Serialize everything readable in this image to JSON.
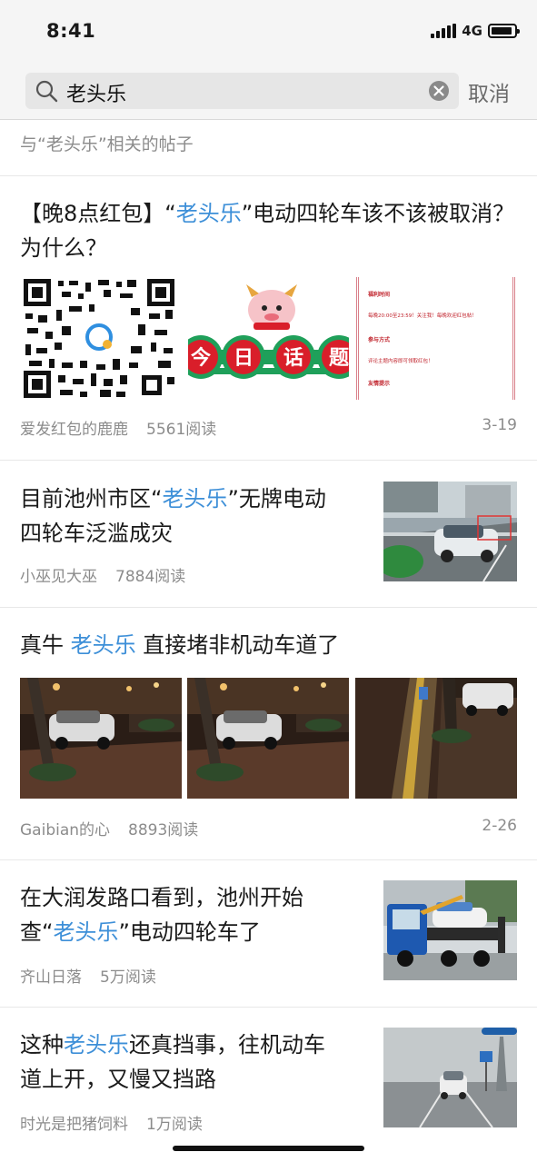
{
  "status": {
    "time": "8:41",
    "network": "4G",
    "battery_level": 0.9
  },
  "search": {
    "query": "老头乐",
    "cancel_label": "取消"
  },
  "section_title": "与“老头乐”相关的帖子",
  "posts": [
    {
      "title_pre": "【晚8点红包】“",
      "title_kw": "老头乐",
      "title_post": "”电动四轮车该不该被取消？为什么？",
      "author": "爱发红包的鹿鹿",
      "reads": "5561阅读",
      "date": "3-19",
      "banner": {
        "chars": [
          "今",
          "日",
          "话",
          "题"
        ],
        "notice_heading_1": "福利时间",
        "notice_text_1": "每晚20:00至23:59！关注我！每晚欢迎红包帖！",
        "notice_heading_2": "参与方式",
        "notice_text_2": "评论主题内容即可领取红包！",
        "notice_heading_3": "友情提示"
      }
    },
    {
      "title_pre": "目前池州市区“",
      "title_kw": "老头乐",
      "title_post": "”无牌电动四轮车泛滥成灾",
      "author": "小巫见大巫",
      "reads": "7884阅读"
    },
    {
      "title_pre": "真牛 ",
      "title_kw": "老头乐",
      "title_post": " 直接堵非机动车道了",
      "author": "Gaibian的心",
      "reads": "8893阅读",
      "date": "2-26"
    },
    {
      "title_pre": "在大润发路口看到，池州开始查“",
      "title_kw": "老头乐",
      "title_post": "”电动四轮车了",
      "author": "齐山日落",
      "reads": "5万阅读"
    },
    {
      "title_pre": "这种",
      "title_kw": "老头乐",
      "title_post": "还真挡事，往机动车道上开，又慢又挡路",
      "author": "时光是把猪饲料",
      "reads": "1万阅读"
    }
  ],
  "colors": {
    "keyword": "#3d8fd8",
    "banner_red": "#d91e2a",
    "banner_green": "#1fa05a"
  }
}
